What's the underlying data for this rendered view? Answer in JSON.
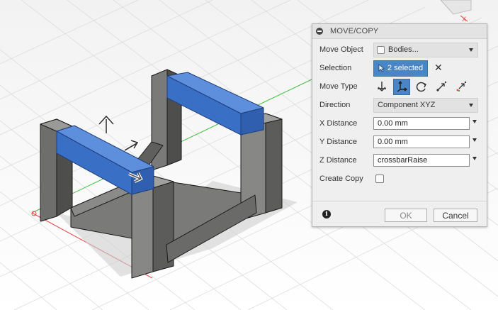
{
  "dialog": {
    "title": "MOVE/COPY",
    "move_object": {
      "label": "Move Object",
      "value": "Bodies..."
    },
    "selection": {
      "label": "Selection",
      "value": "2 selected"
    },
    "move_type": {
      "label": "Move Type",
      "options": [
        "free-move",
        "translate",
        "rotate",
        "point-to-point",
        "point-to-position"
      ],
      "active": "translate"
    },
    "direction": {
      "label": "Direction",
      "value": "Component XYZ"
    },
    "x_distance": {
      "label": "X Distance",
      "value": "0.00 mm"
    },
    "y_distance": {
      "label": "Y Distance",
      "value": "0.00 mm"
    },
    "z_distance": {
      "label": "Z Distance",
      "value": "crossbarRaise"
    },
    "create_copy": {
      "label": "Create Copy",
      "checked": false
    },
    "ok_label": "OK",
    "cancel_label": "Cancel"
  },
  "viewport": {
    "axis_x_color": "#e04646",
    "axis_y_color": "#3fbf3f",
    "selected_color": "#3a6fc6",
    "body_color": "#6d6d6b"
  }
}
